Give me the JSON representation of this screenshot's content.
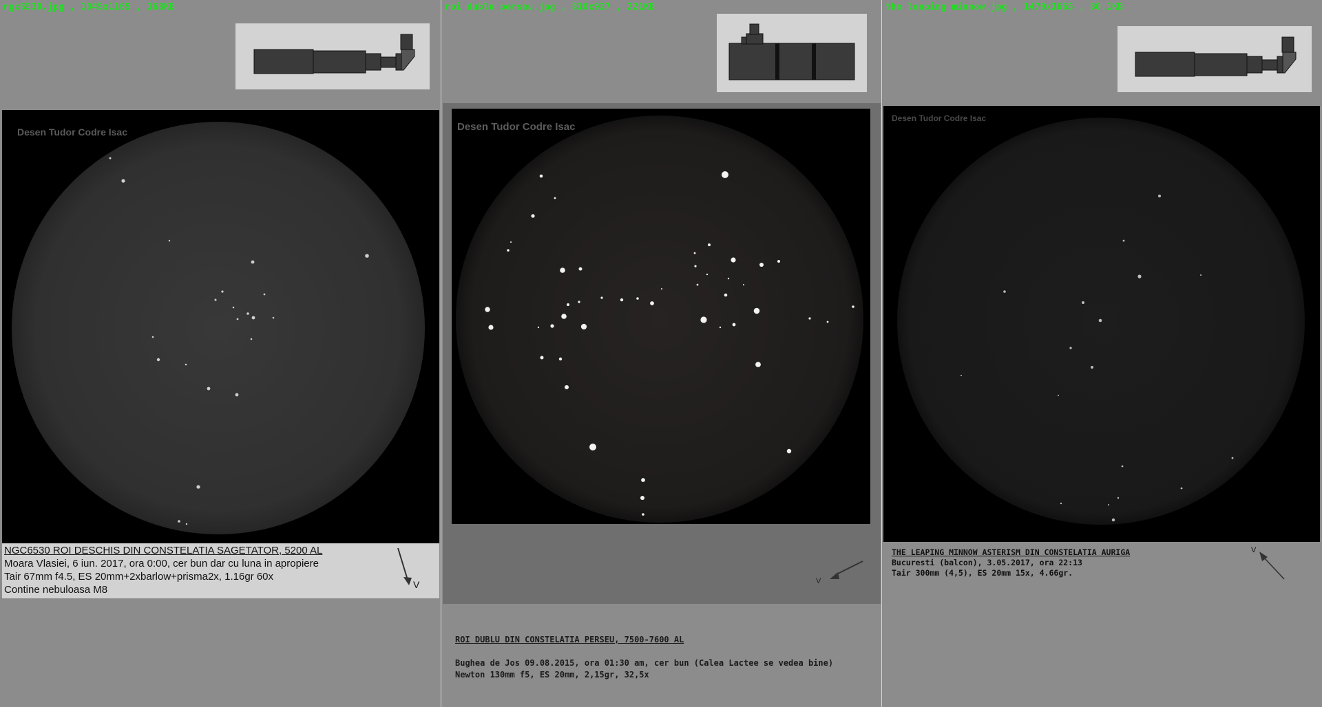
{
  "panels": [
    {
      "filename": "ngc6530.jpg",
      "dims": "1045x1165",
      "size": "168KB",
      "watermark": "Desen Tudor Codre Isac",
      "title": "NGC6530 ROI DESCHIS DIN CONSTELATIA SAGETATOR, 5200 AL",
      "lines": [
        "Moara Vlasiei, 6 iun. 2017, ora 0:00, cer bun dar cu luna in apropiere",
        "Tair 67mm f4.5, ES 20mm+2xbarlow+prisma2x, 1.16gr 60x",
        "Contine nebuloasa M8"
      ],
      "north_label": "V"
    },
    {
      "filename": "roi dublu perseu.jpg",
      "dims": "810x927",
      "size": "221KB",
      "watermark": "Desen Tudor Codre Isac",
      "title": "ROI DUBLU DIN CONSTELATIA PERSEU, 7500-7600 AL",
      "lines": [
        "Bughea de Jos 09.08.2015, ora 01:30 am, cer bun (Calea Lactee se vedea bine)",
        "Newton 130mm f5, ES 20mm, 2,15gr, 32,5x"
      ],
      "north_label": "V"
    },
    {
      "filename": "the leaping minnow.jpg",
      "dims": "1470x1665",
      "size": "80.1KB",
      "watermark": "Desen Tudor Codre Isac",
      "title": "THE LEAPING MINNOW ASTERISM DIN CONSTELATIA AURIGA",
      "lines": [
        "Bucuresti (balcon), 3.05.2017, ora 22:13",
        "Tair 300mm (4,5), ES 20mm 15x, 4.66gr."
      ],
      "north_label": "V"
    }
  ],
  "separator": " , "
}
